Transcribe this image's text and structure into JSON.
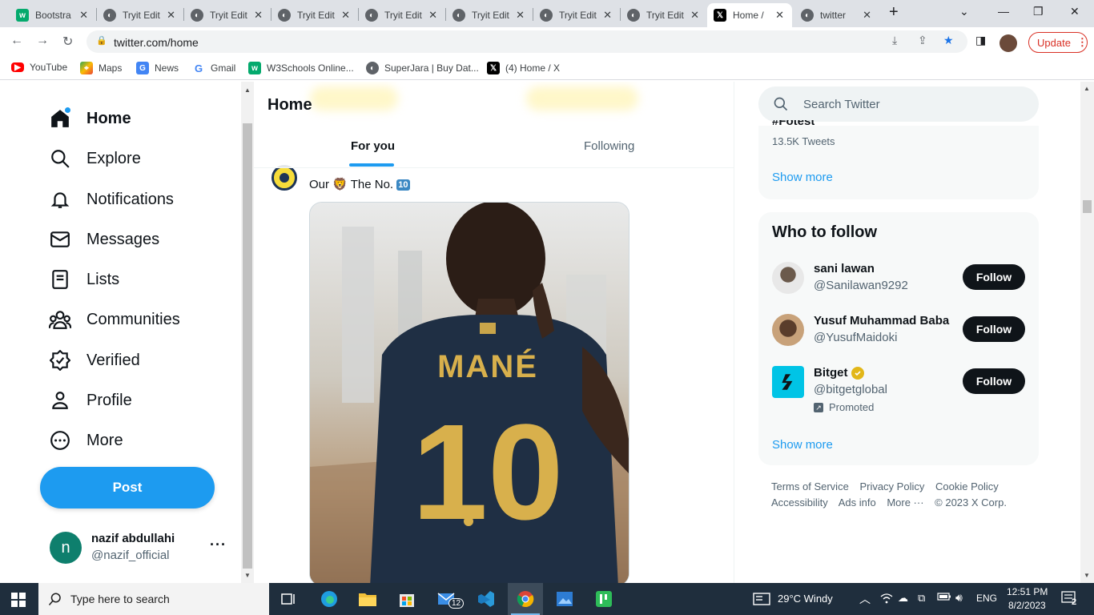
{
  "browser": {
    "tabs": [
      {
        "label": "Bootstra",
        "icon": "w3schools-icon"
      },
      {
        "label": "Tryit Edit",
        "icon": "globe-icon"
      },
      {
        "label": "Tryit Edit",
        "icon": "globe-icon"
      },
      {
        "label": "Tryit Edit",
        "icon": "globe-icon"
      },
      {
        "label": "Tryit Edit",
        "icon": "globe-icon"
      },
      {
        "label": "Tryit Edit",
        "icon": "globe-icon"
      },
      {
        "label": "Tryit Edit",
        "icon": "globe-icon"
      },
      {
        "label": "Tryit Edit",
        "icon": "globe-icon"
      },
      {
        "label": "Home /",
        "icon": "x-logo-icon",
        "active": true
      },
      {
        "label": "twitter",
        "icon": "globe-icon"
      }
    ],
    "url": "twitter.com/home",
    "update_label": "Update",
    "bookmarks": [
      {
        "label": "YouTube",
        "icon": "youtube-icon"
      },
      {
        "label": "Maps",
        "icon": "maps-icon"
      },
      {
        "label": "News",
        "icon": "news-icon"
      },
      {
        "label": "Gmail",
        "icon": "google-icon"
      },
      {
        "label": "W3Schools Online...",
        "icon": "w3schools-icon"
      },
      {
        "label": "SuperJara | Buy Dat...",
        "icon": "globe-icon"
      },
      {
        "label": "(4) Home / X",
        "icon": "x-logo-icon"
      }
    ]
  },
  "sidebar": {
    "nav": [
      {
        "label": "Home",
        "icon": "home-icon",
        "active": true
      },
      {
        "label": "Explore",
        "icon": "search-icon"
      },
      {
        "label": "Notifications",
        "icon": "bell-icon"
      },
      {
        "label": "Messages",
        "icon": "envelope-icon"
      },
      {
        "label": "Lists",
        "icon": "list-icon"
      },
      {
        "label": "Communities",
        "icon": "communities-icon"
      },
      {
        "label": "Verified",
        "icon": "verified-icon"
      },
      {
        "label": "Profile",
        "icon": "person-icon"
      },
      {
        "label": "More",
        "icon": "more-circle-icon"
      }
    ],
    "post_label": "Post",
    "account": {
      "initial": "n",
      "name": "nazif abdullahi",
      "handle": "@nazif_official",
      "more": "···"
    }
  },
  "main": {
    "title": "Home",
    "tabs": [
      {
        "label": "For you",
        "active": true
      },
      {
        "label": "Following"
      }
    ],
    "tweet": {
      "text_before": "Our 🦁 The No. ",
      "number_badge": "10"
    }
  },
  "right": {
    "search_placeholder": "Search Twitter",
    "trend": {
      "name": "#Fotest",
      "count": "13.5K Tweets",
      "show_more": "Show more"
    },
    "who_to_follow": {
      "title": "Who to follow",
      "users": [
        {
          "name": "sani lawan",
          "handle": "@Sanilawan9292",
          "button": "Follow"
        },
        {
          "name": "Yusuf Muhammad Baba",
          "handle": "@YusufMaidoki",
          "button": "Follow"
        },
        {
          "name": "Bitget",
          "handle": "@bitgetglobal",
          "button": "Follow",
          "verified": true,
          "promoted": "Promoted"
        }
      ],
      "show_more": "Show more"
    },
    "footer": {
      "row1": [
        "Terms of Service",
        "Privacy Policy",
        "Cookie Policy"
      ],
      "row2": [
        "Accessibility",
        "Ads info",
        "More ···",
        "© 2023 X Corp."
      ]
    }
  },
  "taskbar": {
    "search_placeholder": "Type here to search",
    "mail_badge": "12",
    "weather": "29°C  Windy",
    "language": "ENG",
    "time": "12:51 PM",
    "date": "8/2/2023",
    "notification_count": "2"
  }
}
